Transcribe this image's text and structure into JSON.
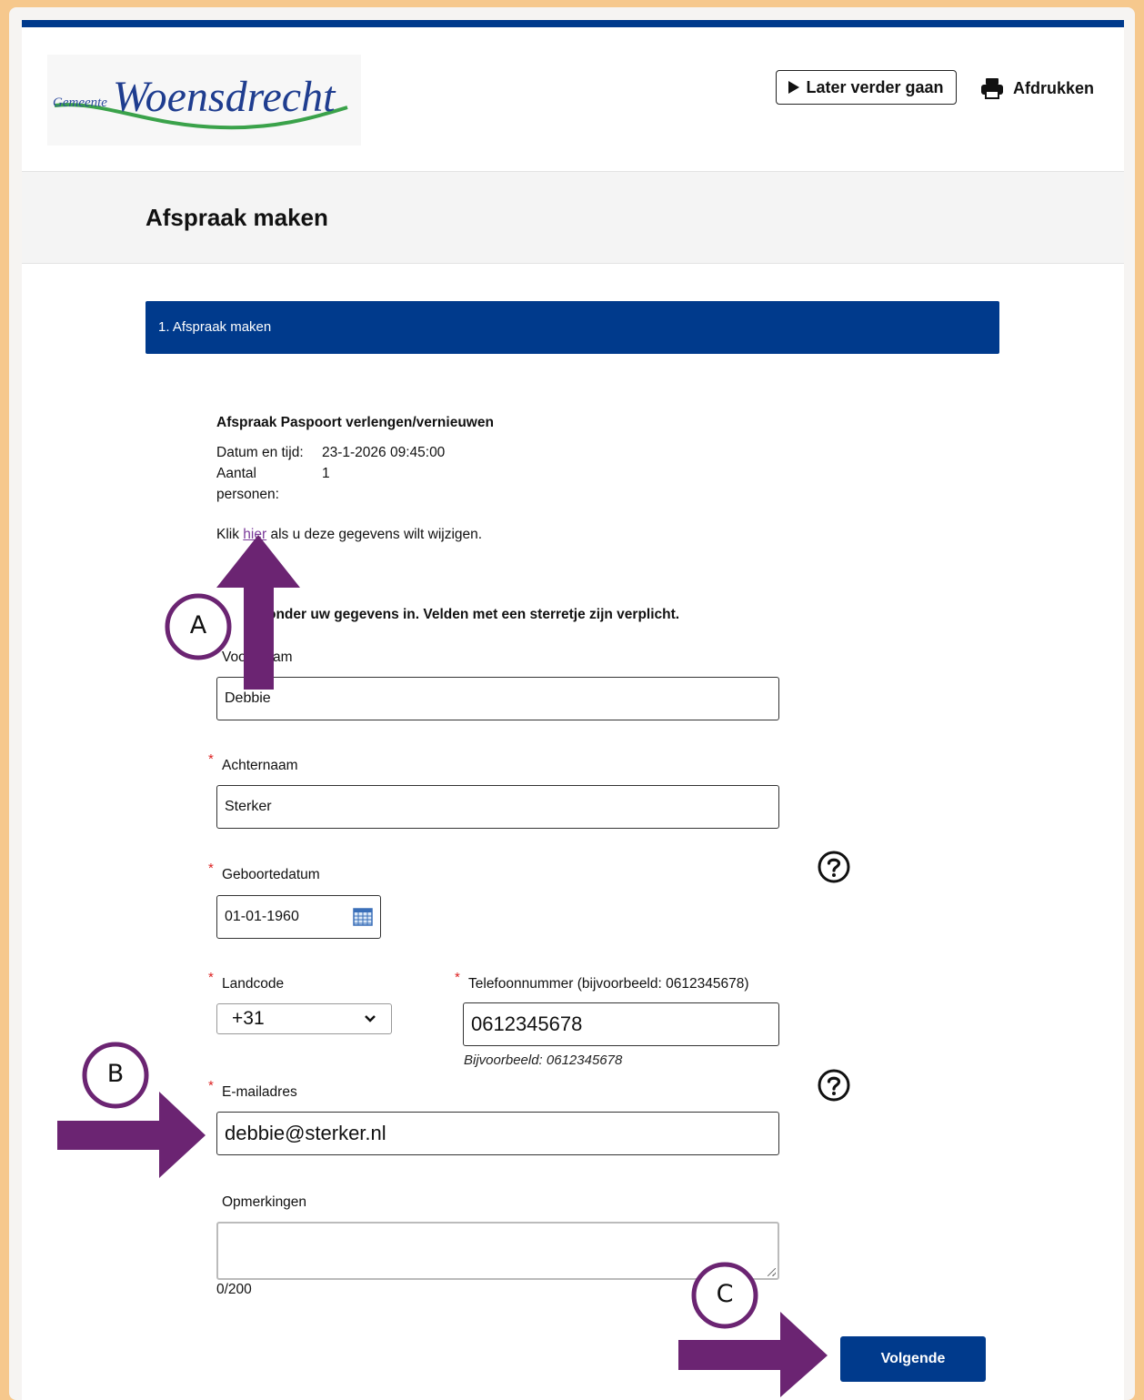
{
  "header": {
    "logo_small": "Gemeente",
    "logo_big": "Woensdrecht",
    "later_button": "Later verder gaan",
    "print_button": "Afdrukken"
  },
  "page_title": "Afspraak maken",
  "step": "1. Afspraak maken",
  "appointment": {
    "title": "Afspraak Paspoort verlengen/vernieuwen",
    "date_label": "Datum en tijd:",
    "date_value": "23-1-2026 09:45:00",
    "count_label_1": "Aantal",
    "count_label_2": "personen:",
    "count_value": "1",
    "change_prefix": "Klik",
    "change_link": "hier",
    "change_suffix": "als u deze gegevens wilt wijzigen."
  },
  "form": {
    "intro_start": "Vul hieronder uw gegevens in. Velden met een sterretje zijn verplicht.",
    "intro_visible": "onder uw gegevens in. Velden met een sterretje zijn verplicht.",
    "firstname_label_a": "Voo",
    "firstname_label_b": "am",
    "firstname_value": "Debbie",
    "lastname_label": "Achternaam",
    "lastname_value": "Sterker",
    "birthdate_label": "Geboortedatum",
    "birthdate_value": "01-01-1960",
    "countrycode_label": "Landcode",
    "countrycode_value": "+31",
    "phone_label": "Telefoonnummer (bijvoorbeeld: 0612345678)",
    "phone_value": "0612345678",
    "phone_hint": "Bijvoorbeeld: 0612345678",
    "email_label": "E-mailadres",
    "email_value": "debbie@sterker.nl",
    "remarks_label": "Opmerkingen",
    "remarks_counter": "0/200",
    "required_mark": "*"
  },
  "next_button": "Volgende",
  "annotations": {
    "a": "A",
    "b": "B",
    "c": "C",
    "color": "#6b2472"
  },
  "colors": {
    "brand_blue": "#003a8c",
    "frame": "#f6c88d",
    "link": "#7a3a9a",
    "required": "#dd2222"
  }
}
